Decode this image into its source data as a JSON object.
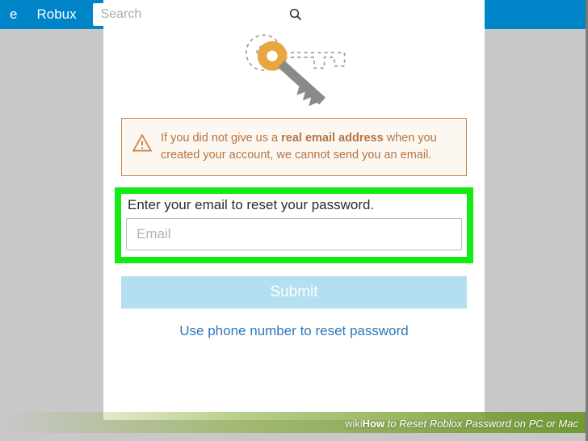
{
  "nav": {
    "item1_partial": "e",
    "robux": "Robux",
    "search_placeholder": "Search"
  },
  "notice": {
    "text_before": "If you did not give us a ",
    "text_bold": "real email address",
    "text_after": " when you created your account, we cannot send you an email."
  },
  "reset": {
    "instruction": "Enter your email to reset your password.",
    "email_placeholder": "Email",
    "submit_label": "Submit",
    "phone_link": "Use phone number to reset password"
  },
  "footer": {
    "wiki": "wiki",
    "how": "How",
    "title": " to Reset Roblox Password on PC or Mac"
  }
}
